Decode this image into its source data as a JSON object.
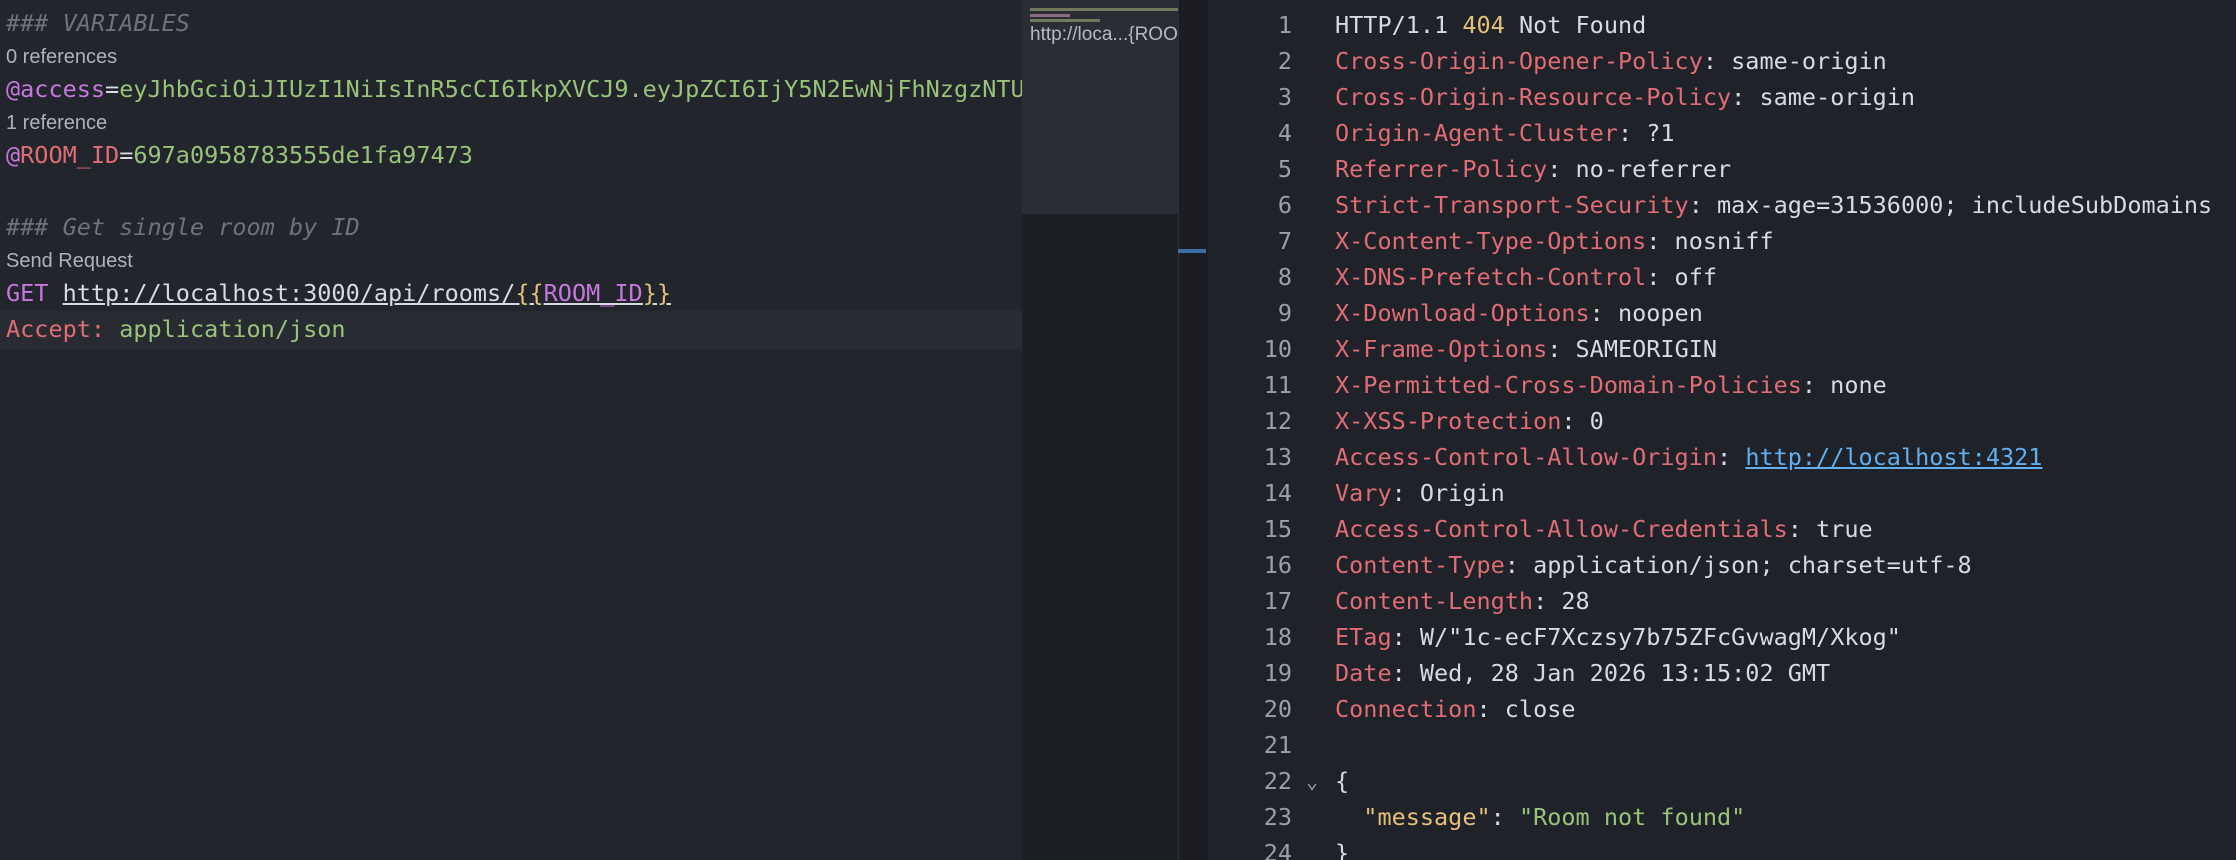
{
  "editor": {
    "comment_variables": "### VARIABLES",
    "lens_0_refs": "0 references",
    "access_var": "@access",
    "access_eq": "=",
    "access_value": "eyJhbGciOiJIUzI1NiIsInR5cCI6IkpXVCJ9.eyJpZCI6IjY5N2EwNjFhNzgzNTU",
    "lens_1_ref": "1 reference",
    "room_var_at": "@",
    "room_var_name": "ROOM_ID",
    "room_eq": "=",
    "room_value": "697a0958783555de1fa97473",
    "comment_get": "### Get single room by ID",
    "send_request": "Send Request",
    "method": "GET",
    "url_base": "http://localhost:3000/api/rooms/",
    "url_open": "{{",
    "url_var": "ROOM_ID",
    "url_close": "}}",
    "header_name": "Accept:",
    "header_value": "application/json"
  },
  "minimap": {
    "label": "http://loca...{ROOM_ID}}"
  },
  "response": {
    "lines": [
      {
        "n": "1",
        "parts": [
          [
            "plain",
            "HTTP/1.1 "
          ],
          [
            "status",
            "404"
          ],
          [
            "plain",
            " Not Found"
          ]
        ]
      },
      {
        "n": "2",
        "parts": [
          [
            "key",
            "Cross-Origin-Opener-Policy"
          ],
          [
            "plain",
            ": same-origin"
          ]
        ]
      },
      {
        "n": "3",
        "parts": [
          [
            "key",
            "Cross-Origin-Resource-Policy"
          ],
          [
            "plain",
            ": same-origin"
          ]
        ]
      },
      {
        "n": "4",
        "parts": [
          [
            "key",
            "Origin-Agent-Cluster"
          ],
          [
            "plain",
            ": ?1"
          ]
        ]
      },
      {
        "n": "5",
        "parts": [
          [
            "key",
            "Referrer-Policy"
          ],
          [
            "plain",
            ": no-referrer"
          ]
        ]
      },
      {
        "n": "6",
        "parts": [
          [
            "key",
            "Strict-Transport-Security"
          ],
          [
            "plain",
            ": max-age=31536000; includeSubDomains"
          ]
        ]
      },
      {
        "n": "7",
        "parts": [
          [
            "key",
            "X-Content-Type-Options"
          ],
          [
            "plain",
            ": nosniff"
          ]
        ]
      },
      {
        "n": "8",
        "parts": [
          [
            "key",
            "X-DNS-Prefetch-Control"
          ],
          [
            "plain",
            ": off"
          ]
        ]
      },
      {
        "n": "9",
        "parts": [
          [
            "key",
            "X-Download-Options"
          ],
          [
            "plain",
            ": noopen"
          ]
        ]
      },
      {
        "n": "10",
        "parts": [
          [
            "key",
            "X-Frame-Options"
          ],
          [
            "plain",
            ": SAMEORIGIN"
          ]
        ]
      },
      {
        "n": "11",
        "parts": [
          [
            "key",
            "X-Permitted-Cross-Domain-Policies"
          ],
          [
            "plain",
            ": none"
          ]
        ]
      },
      {
        "n": "12",
        "parts": [
          [
            "key",
            "X-XSS-Protection"
          ],
          [
            "plain",
            ": 0"
          ]
        ]
      },
      {
        "n": "13",
        "parts": [
          [
            "key",
            "Access-Control-Allow-Origin"
          ],
          [
            "plain",
            ": "
          ],
          [
            "link",
            "http://localhost:4321"
          ]
        ]
      },
      {
        "n": "14",
        "parts": [
          [
            "key",
            "Vary"
          ],
          [
            "plain",
            ": Origin"
          ]
        ]
      },
      {
        "n": "15",
        "parts": [
          [
            "key",
            "Access-Control-Allow-Credentials"
          ],
          [
            "plain",
            ": true"
          ]
        ]
      },
      {
        "n": "16",
        "parts": [
          [
            "key",
            "Content-Type"
          ],
          [
            "plain",
            ": application/json; charset=utf-8"
          ]
        ]
      },
      {
        "n": "17",
        "parts": [
          [
            "key",
            "Content-Length"
          ],
          [
            "plain",
            ": 28"
          ]
        ]
      },
      {
        "n": "18",
        "parts": [
          [
            "key",
            "ETag"
          ],
          [
            "plain",
            ": W/\"1c-ecF7Xczsy7b75ZFcGvwagM/Xkog\""
          ]
        ]
      },
      {
        "n": "19",
        "parts": [
          [
            "key",
            "Date"
          ],
          [
            "plain",
            ": Wed, 28 Jan 2026 13:15:02 GMT"
          ]
        ]
      },
      {
        "n": "20",
        "parts": [
          [
            "key",
            "Connection"
          ],
          [
            "plain",
            ": close"
          ]
        ]
      },
      {
        "n": "21",
        "parts": []
      },
      {
        "n": "22",
        "parts": [
          [
            "plain",
            "{"
          ]
        ],
        "fold": "⌄"
      },
      {
        "n": "23",
        "parts": [
          [
            "plain",
            "  "
          ],
          [
            "jkey",
            "\"message\""
          ],
          [
            "plain",
            ": "
          ],
          [
            "jstr",
            "\"Room not found\""
          ]
        ]
      },
      {
        "n": "24",
        "parts": [
          [
            "plain",
            "}"
          ]
        ]
      }
    ]
  }
}
